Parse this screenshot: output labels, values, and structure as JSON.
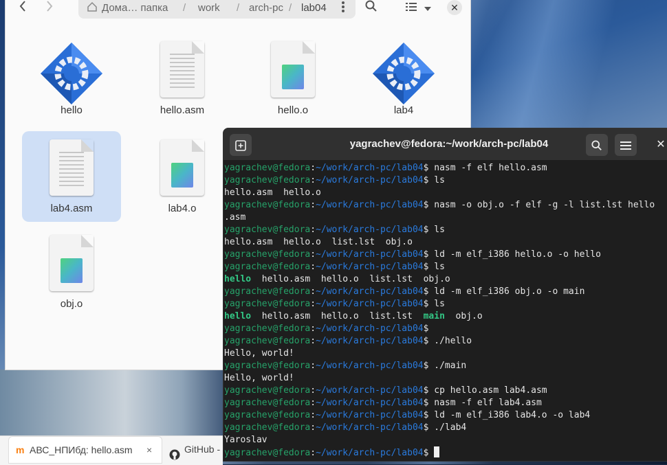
{
  "files": {
    "back_icon": "chevron-left",
    "forward_icon": "chevron-right",
    "breadcrumb": {
      "home": "Дома… папка",
      "parts": [
        "work",
        "arch-pc",
        "lab04"
      ],
      "separator": "/"
    },
    "menu_icon": "vertical-dots",
    "search_icon": "magnifier",
    "view_icon": "list-view",
    "sort_icon": "chevron-down",
    "close_icon": "close",
    "items": [
      {
        "label": "hello",
        "type": "executable"
      },
      {
        "label": "hello.asm",
        "type": "text"
      },
      {
        "label": "hello.o",
        "type": "object"
      },
      {
        "label": "lab4",
        "type": "executable"
      },
      {
        "label": "lab4.asm",
        "type": "text",
        "selected": true
      },
      {
        "label": "lab4.o",
        "type": "object"
      },
      {
        "label": "obj.o",
        "type": "object"
      }
    ]
  },
  "terminal": {
    "title": "yagrachev@fedora:~/work/arch-pc/lab04",
    "new_tab_icon": "plus-box",
    "search_icon": "magnifier",
    "menu_icon": "hamburger",
    "close_icon": "close",
    "prompt_user": "yagrachev@fedora",
    "prompt_path": "~/work/arch-pc/lab04",
    "lines": [
      {
        "kind": "cmd",
        "text": "nasm -f elf hello.asm"
      },
      {
        "kind": "cmd",
        "text": "ls"
      },
      {
        "kind": "out",
        "text": "hello.asm  hello.o"
      },
      {
        "kind": "cmd",
        "text": "nasm -o obj.o -f elf -g -l list.lst hello"
      },
      {
        "kind": "out",
        "text": ".asm"
      },
      {
        "kind": "cmd",
        "text": "ls"
      },
      {
        "kind": "out",
        "text": "hello.asm  hello.o  list.lst  obj.o"
      },
      {
        "kind": "cmd",
        "text": "ld -m elf_i386 hello.o -o hello"
      },
      {
        "kind": "cmd",
        "text": "ls"
      },
      {
        "kind": "ls",
        "parts": [
          {
            "t": "hello",
            "exe": true
          },
          {
            "t": "  hello.asm  hello.o  list.lst  obj.o",
            "exe": false
          }
        ]
      },
      {
        "kind": "cmd",
        "text": "ld -m elf_i386 obj.o -o main"
      },
      {
        "kind": "cmd",
        "text": "ls"
      },
      {
        "kind": "ls",
        "parts": [
          {
            "t": "hello",
            "exe": true
          },
          {
            "t": "  hello.asm  hello.o  list.lst  ",
            "exe": false
          },
          {
            "t": "main",
            "exe": true
          },
          {
            "t": "  obj.o",
            "exe": false
          }
        ]
      },
      {
        "kind": "cmd",
        "text": ""
      },
      {
        "kind": "cmd",
        "text": "./hello"
      },
      {
        "kind": "out",
        "text": "Hello, world!"
      },
      {
        "kind": "cmd",
        "text": "./main"
      },
      {
        "kind": "out",
        "text": "Hello, world!"
      },
      {
        "kind": "cmd",
        "text": "cp hello.asm lab4.asm"
      },
      {
        "kind": "cmd",
        "text": "nasm -f elf lab4.asm"
      },
      {
        "kind": "cmd",
        "text": "ld -m elf_i386 lab4.o -o lab4"
      },
      {
        "kind": "cmd",
        "text": "./lab4"
      },
      {
        "kind": "out",
        "text": "Yaroslav"
      },
      {
        "kind": "prompt_cursor",
        "text": ""
      }
    ]
  },
  "taskbar": {
    "tabs": [
      {
        "label": "АВС_НПИбд: hello.asm",
        "icon": "moodle-icon",
        "close": "×"
      },
      {
        "label": "GitHub -",
        "icon": "github-icon"
      }
    ]
  }
}
